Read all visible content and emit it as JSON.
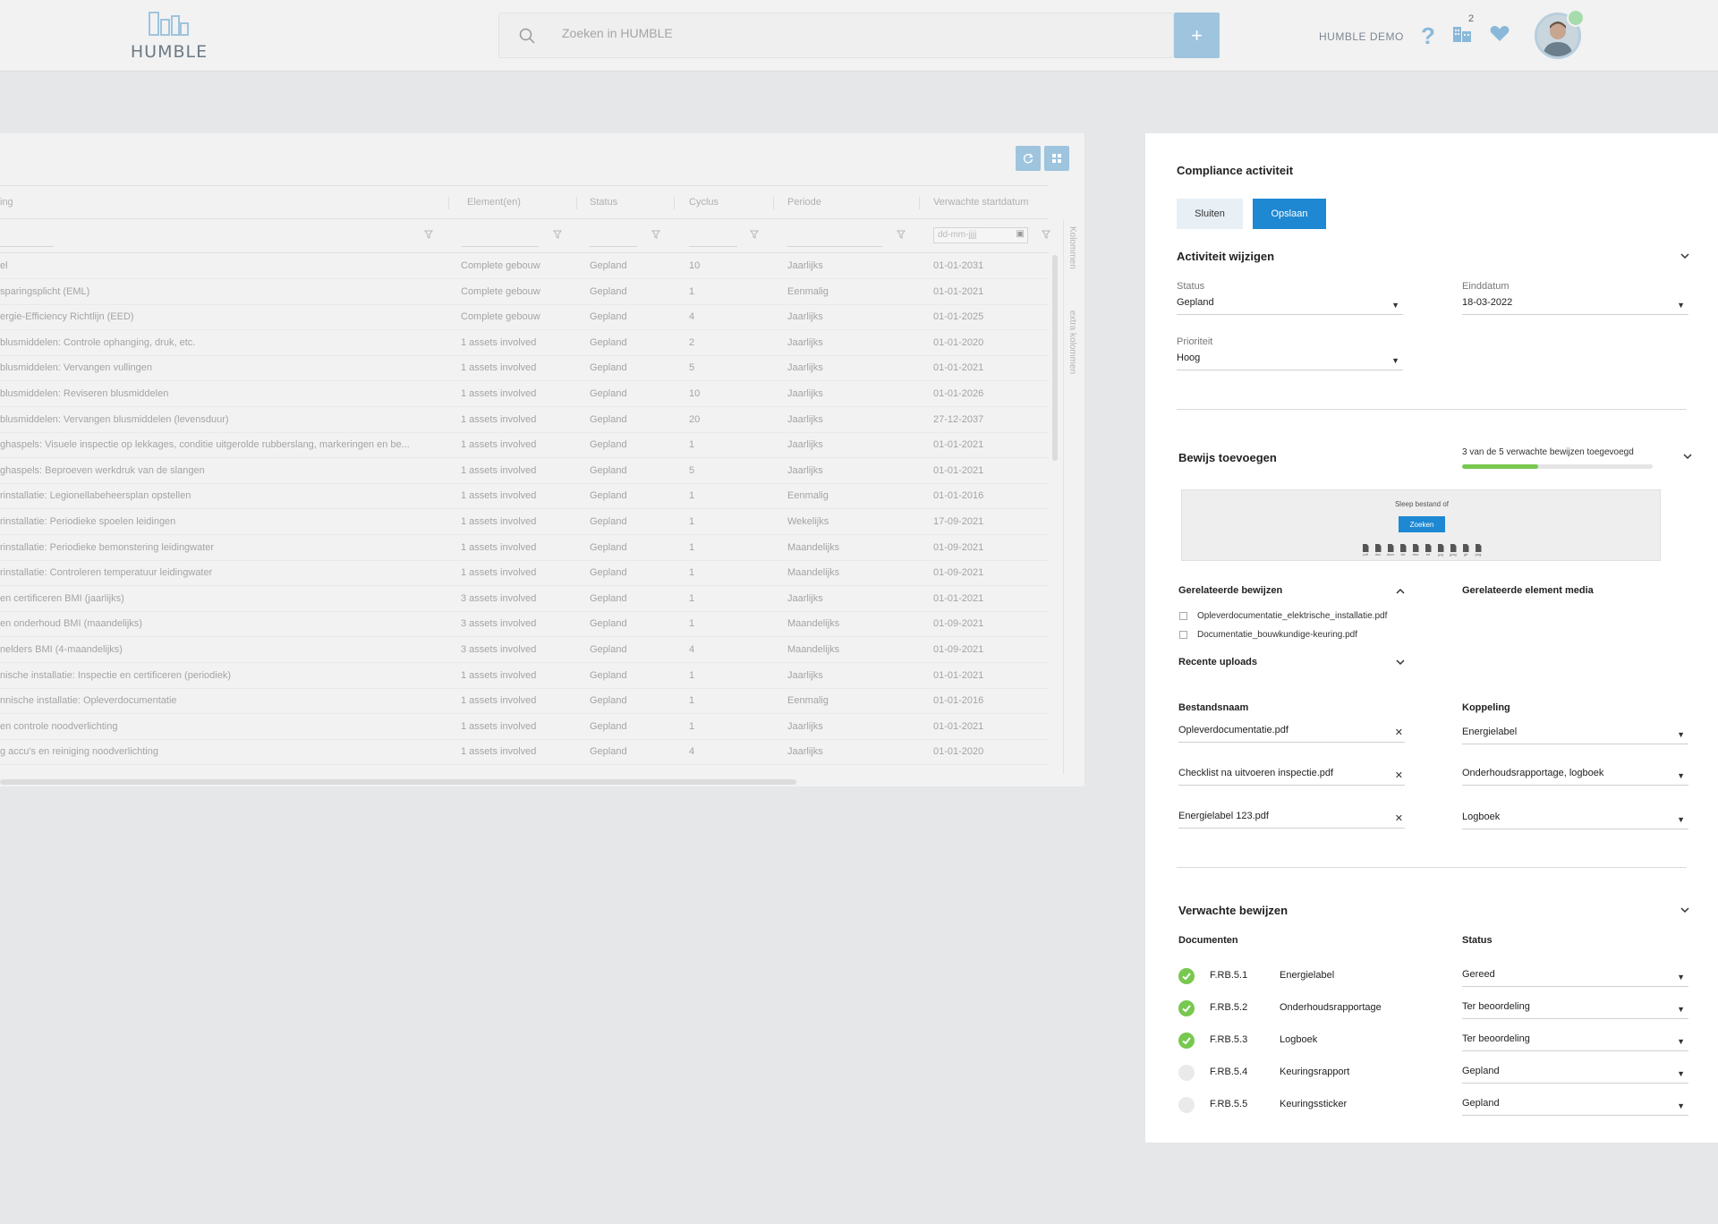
{
  "header": {
    "logo_text": "HUMBLE",
    "search_placeholder": "Zoeken in HUMBLE",
    "add_label": "+",
    "user_name": "HUMBLE DEMO",
    "help_label": "?",
    "building_count": "2",
    "accent_color": "#9ec4de"
  },
  "table": {
    "columns": [
      "ing",
      "Element(en)",
      "Status",
      "Cyclus",
      "Periode",
      "Verwachte startdatum"
    ],
    "date_placeholder": "dd-mm-jjjj",
    "side_tabs": [
      "Kolommen",
      "extra kolommen"
    ],
    "rows": [
      [
        "el",
        "Complete gebouw",
        "Gepland",
        "10",
        "Jaarlijks",
        "01-01-2031"
      ],
      [
        "sparingsplicht (EML)",
        "Complete gebouw",
        "Gepland",
        "1",
        "Eenmalig",
        "01-01-2021"
      ],
      [
        "ergie-Efficiency Richtlijn (EED)",
        "Complete gebouw",
        "Gepland",
        "4",
        "Jaarlijks",
        "01-01-2025"
      ],
      [
        "blusmiddelen: Controle ophanging, druk, etc.",
        "1 assets involved",
        "Gepland",
        "2",
        "Jaarlijks",
        "01-01-2020"
      ],
      [
        "blusmiddelen: Vervangen vullingen",
        "1 assets involved",
        "Gepland",
        "5",
        "Jaarlijks",
        "01-01-2021"
      ],
      [
        "blusmiddelen: Reviseren blusmiddelen",
        "1 assets involved",
        "Gepland",
        "10",
        "Jaarlijks",
        "01-01-2026"
      ],
      [
        "blusmiddelen: Vervangen blusmiddelen (levensduur)",
        "1 assets involved",
        "Gepland",
        "20",
        "Jaarlijks",
        "27-12-2037"
      ],
      [
        "ghaspels: Visuele inspectie op lekkages, conditie uitgerolde rubberslang, markeringen en be...",
        "1 assets involved",
        "Gepland",
        "1",
        "Jaarlijks",
        "01-01-2021"
      ],
      [
        "ghaspels: Beproeven werkdruk van de slangen",
        "1 assets involved",
        "Gepland",
        "5",
        "Jaarlijks",
        "01-01-2021"
      ],
      [
        "rinstallatie: Legionellabeheersplan opstellen",
        "1 assets involved",
        "Gepland",
        "1",
        "Eenmalig",
        "01-01-2016"
      ],
      [
        "rinstallatie: Periodieke spoelen leidingen",
        "1 assets involved",
        "Gepland",
        "1",
        "Wekelijks",
        "17-09-2021"
      ],
      [
        "rinstallatie: Periodieke bemonstering leidingwater",
        "1 assets involved",
        "Gepland",
        "1",
        "Maandelijks",
        "01-09-2021"
      ],
      [
        "rinstallatie: Controleren temperatuur leidingwater",
        "1 assets involved",
        "Gepland",
        "1",
        "Maandelijks",
        "01-09-2021"
      ],
      [
        "en certificeren BMI (jaarlijks)",
        "3 assets involved",
        "Gepland",
        "1",
        "Jaarlijks",
        "01-01-2021"
      ],
      [
        "en onderhoud BMI (maandelijks)",
        "3 assets involved",
        "Gepland",
        "1",
        "Maandelijks",
        "01-09-2021"
      ],
      [
        "nelders BMI (4-maandelijks)",
        "3 assets involved",
        "Gepland",
        "4",
        "Maandelijks",
        "01-09-2021"
      ],
      [
        "nische installatie: Inspectie en certificeren (periodiek)",
        "1 assets involved",
        "Gepland",
        "1",
        "Jaarlijks",
        "01-01-2021"
      ],
      [
        "nnische installatie: Opleverdocumentatie",
        "1 assets involved",
        "Gepland",
        "1",
        "Eenmalig",
        "01-01-2016"
      ],
      [
        "en controle noodverlichting",
        "1 assets involved",
        "Gepland",
        "1",
        "Jaarlijks",
        "01-01-2021"
      ],
      [
        "g accu's en reiniging noodverlichting",
        "1 assets involved",
        "Gepland",
        "4",
        "Jaarlijks",
        "01-01-2020"
      ]
    ]
  },
  "panel": {
    "title": "Compliance activiteit",
    "close_label": "Sluiten",
    "save_label": "Opslaan",
    "primary_color": "#1e88d2",
    "edit": {
      "title": "Activiteit wijzigen",
      "status_label": "Status",
      "status_value": "Gepland",
      "end_label": "Einddatum",
      "end_value": "18-03-2022",
      "priority_label": "Prioriteit",
      "priority_value": "Hoog"
    },
    "evidence": {
      "title": "Bewijs toevoegen",
      "progress_text": "3 van de 5 verwachte bewijzen toegevoegd",
      "progress_fraction": 0.4,
      "progress_color": "#78c84f",
      "dropzone_text": "Sleep bestand of",
      "dropzone_button": "Zoeken",
      "filetypes": [
        "pdf",
        "doc",
        "docx",
        "xls",
        "xlsx",
        "txt",
        "jpg",
        "jpeg",
        "gif",
        "png"
      ],
      "related_title": "Gerelateerde bewijzen",
      "related_media_title": "Gerelateerde element media",
      "related_files": [
        "Opleverdocumentatie_elektrische_installatie.pdf",
        "Documentatie_bouwkundige-keuring.pdf"
      ],
      "recent_title": "Recente uploads",
      "filename_label": "Bestandsnaam",
      "link_label": "Koppeling",
      "uploads": [
        {
          "name": "Opleverdocumentatie.pdf",
          "link": "Energielabel"
        },
        {
          "name": "Checklist na uitvoeren inspectie.pdf",
          "link": "Onderhoudsrapportage, logboek"
        },
        {
          "name": "Energielabel 123.pdf",
          "link": "Logboek"
        }
      ]
    },
    "expected": {
      "title": "Verwachte bewijzen",
      "docs_label": "Documenten",
      "status_label": "Status",
      "items": [
        {
          "code": "F.RB.5.1",
          "name": "Energielabel",
          "status": "Gereed",
          "done": true
        },
        {
          "code": "F.RB.5.2",
          "name": "Onderhoudsrapportage",
          "status": "Ter beoordeling",
          "done": true
        },
        {
          "code": "F.RB.5.3",
          "name": "Logboek",
          "status": "Ter beoordeling",
          "done": true
        },
        {
          "code": "F.RB.5.4",
          "name": "Keuringsrapport",
          "status": "Gepland",
          "done": false
        },
        {
          "code": "F.RB.5.5",
          "name": "Keuringssticker",
          "status": "Gepland",
          "done": false
        }
      ]
    }
  }
}
